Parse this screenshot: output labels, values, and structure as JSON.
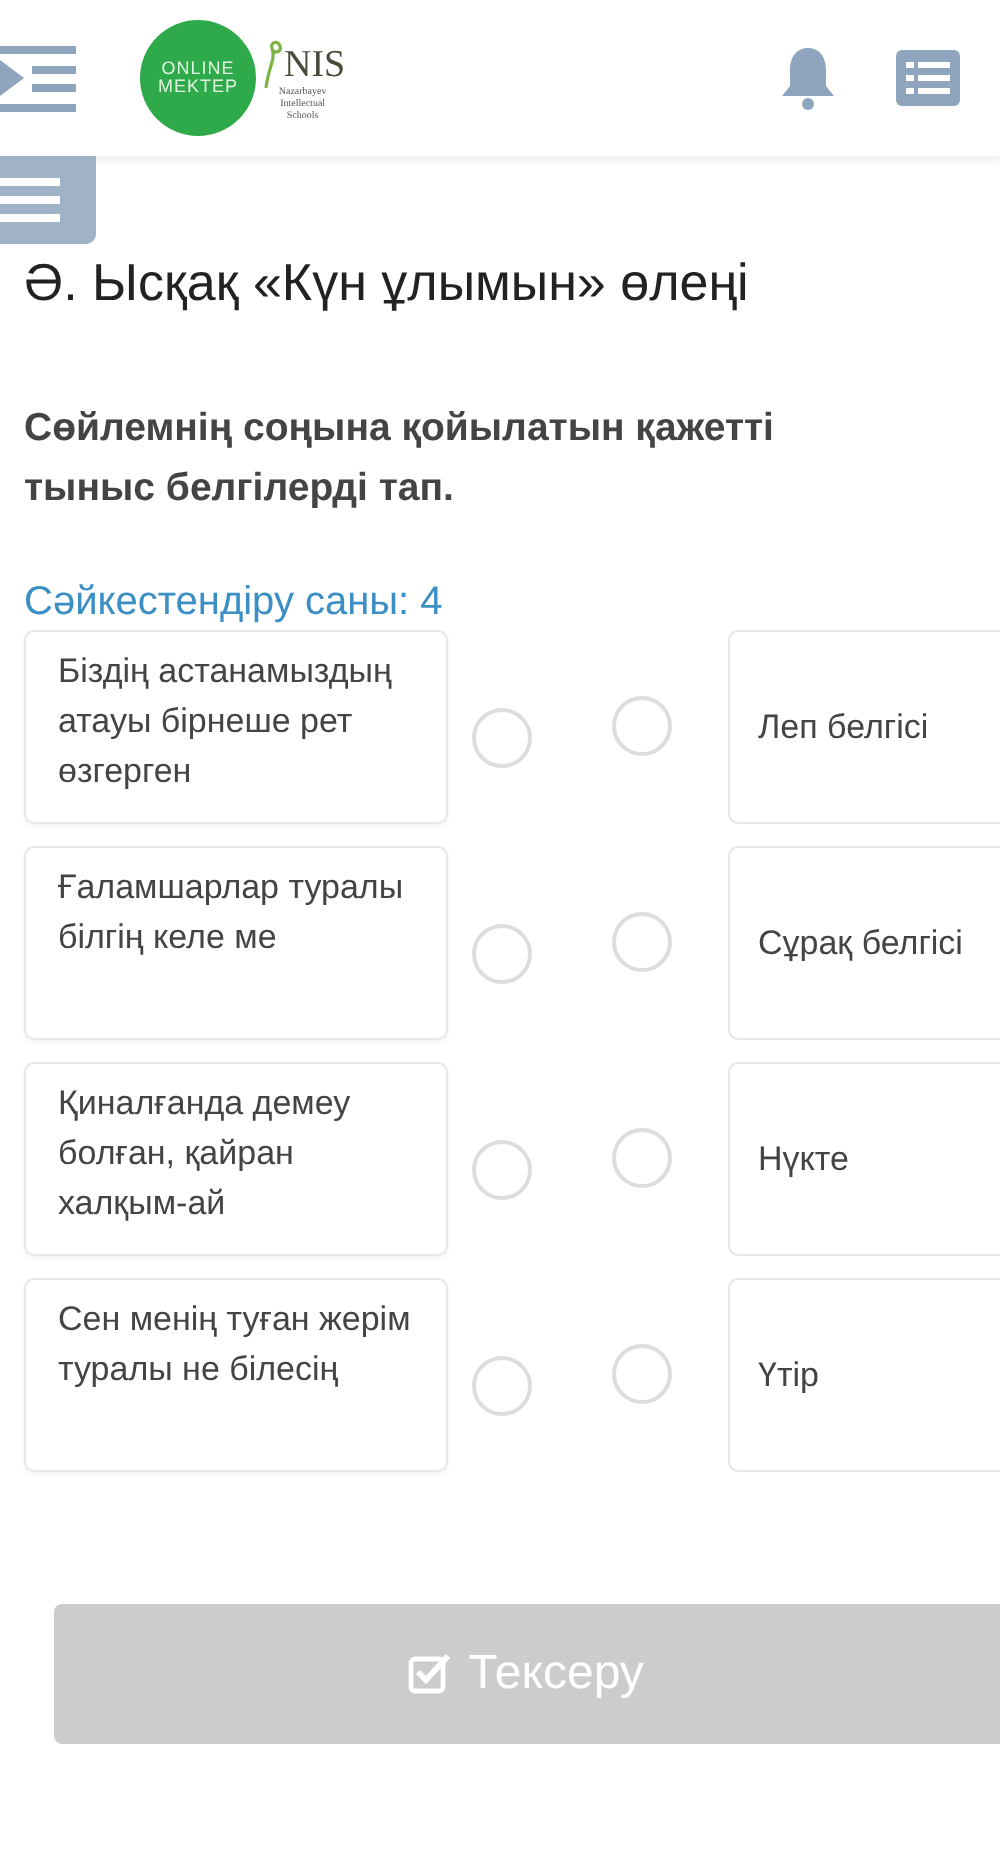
{
  "header": {
    "logo": {
      "circle_lines": [
        "ONLINE",
        "MEKTEP"
      ],
      "brand": "NIS",
      "brand_lines": [
        "Nazarbayev",
        "Intellectual",
        "Schools"
      ]
    }
  },
  "title": "Ә. Ысқақ «Күн ұлымын» өлеңі",
  "question": [
    "Сөйлемнің соңына қойылатын қажетті",
    "тыныс белгілерді тап."
  ],
  "match_count": "Сәйкестендіру саны: 4",
  "pairs": [
    {
      "left": {
        "text": "Біздің астанамыздың атауы бірнеше рет өзгерген",
        "selected": false
      },
      "right": {
        "text": "Леп белгісі",
        "selected": false
      }
    },
    {
      "left": {
        "text": "Ғаламшарлар туралы білгің келе ме",
        "selected": false
      },
      "right": {
        "text": "Сұрақ белгісі",
        "selected": false
      }
    },
    {
      "left": {
        "text": "Қиналғанда демеу болған, қайран халқым-ай",
        "selected": false
      },
      "right": {
        "text": "Нүкте",
        "selected": false
      }
    },
    {
      "left": {
        "text": "Сен менің туған жерім туралы не білесің",
        "selected": false
      },
      "right": {
        "text": "Үтір",
        "selected": false
      }
    }
  ],
  "check_button": {
    "label": "Тексеру",
    "disabled": true
  }
}
